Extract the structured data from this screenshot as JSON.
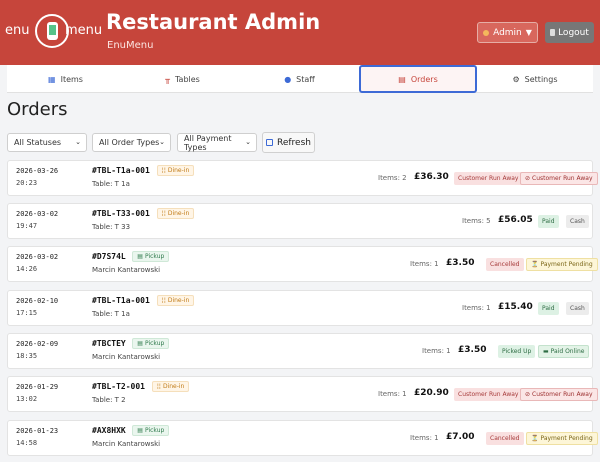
{
  "header": {
    "logo_left": "enu",
    "logo_right": "menu",
    "title": "Restaurant Admin",
    "subtitle": "EnuMenu",
    "admin_label": "Admin",
    "logout_label": "Logout"
  },
  "nav": {
    "tabs": [
      {
        "label": "Items",
        "icon": "items-icon"
      },
      {
        "label": "Tables",
        "icon": "tables-icon"
      },
      {
        "label": "Staff",
        "icon": "staff-icon"
      },
      {
        "label": "Orders",
        "icon": "orders-icon",
        "active": true
      },
      {
        "label": "Settings",
        "icon": "gear-icon"
      }
    ]
  },
  "page": {
    "title": "Orders"
  },
  "filters": {
    "status": "All Statuses",
    "order_type": "All Order Types",
    "payment_type": "All Payment Types",
    "refresh_label": "Refresh"
  },
  "orders": [
    {
      "date": "2026-03-26",
      "time": "20:23",
      "code": "#TBL-T1a-001",
      "type": "Dine-in",
      "sub": "Table: T 1a",
      "items": "Items: 2",
      "amount": "£36.30",
      "status": "Customer Run Away",
      "payment": "Customer Run Away"
    },
    {
      "date": "2026-03-02",
      "time": "19:47",
      "code": "#TBL-T33-001",
      "type": "Dine-in",
      "sub": "Table: T 33",
      "items": "Items: 5",
      "amount": "£56.05",
      "status": "Paid",
      "payment": "Cash"
    },
    {
      "date": "2026-03-02",
      "time": "14:26",
      "code": "#D7S74L",
      "type": "Pickup",
      "sub": "Marcin Kantarowski",
      "items": "Items: 1",
      "amount": "£3.50",
      "status": "Cancelled",
      "payment": "Payment Pending"
    },
    {
      "date": "2026-02-10",
      "time": "17:15",
      "code": "#TBL-T1a-001",
      "type": "Dine-in",
      "sub": "Table: T 1a",
      "items": "Items: 1",
      "amount": "£15.40",
      "status": "Paid",
      "payment": "Cash"
    },
    {
      "date": "2026-02-09",
      "time": "18:35",
      "code": "#TBCTEY",
      "type": "Pickup",
      "sub": "Marcin Kantarowski",
      "items": "Items: 1",
      "amount": "£3.50",
      "status": "Picked Up",
      "payment": "Paid Online"
    },
    {
      "date": "2026-01-29",
      "time": "13:02",
      "code": "#TBL-T2-001",
      "type": "Dine-in",
      "sub": "Table: T 2",
      "items": "Items: 1",
      "amount": "£20.90",
      "status": "Customer Run Away",
      "payment": "Customer Run Away"
    },
    {
      "date": "2026-01-23",
      "time": "14:58",
      "code": "#AX8HXK",
      "type": "Pickup",
      "sub": "Marcin Kantarowski",
      "items": "Items: 1",
      "amount": "£7.00",
      "status": "Cancelled",
      "payment": "Payment Pending"
    }
  ]
}
